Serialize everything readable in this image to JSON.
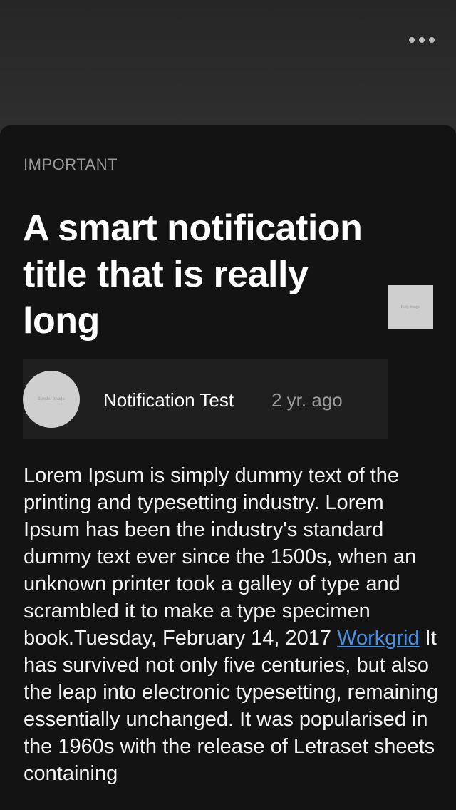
{
  "header": {
    "more_icon": "more-horizontal-icon"
  },
  "notification": {
    "category": "IMPORTANT",
    "title": "A smart notification title that is really long",
    "body_image_label": "Body Image",
    "sender_image_label": "Sender Image",
    "sender_name": "Notification Test",
    "timestamp": "2 yr. ago",
    "body_part1": "Lorem Ipsum is simply dummy text of the printing and typesetting industry. Lorem Ipsum has been the industry's standard dummy text ever since the 1500s, when an unknown printer took a galley of type and scrambled it to make a type specimen book.Tuesday, February 14, 2017 ",
    "body_link": "Workgrid",
    "body_part2": " It has survived not only five centuries, but also the leap into electronic typesetting, remaining essentially unchanged. It was popularised in the 1960s with the release of Letraset sheets containing"
  },
  "colors": {
    "background": "#2a2a2a",
    "sheet": "#131313",
    "meta_row": "#1f1f1f",
    "link": "#4a90e2",
    "muted_text": "#9a9a9a"
  }
}
